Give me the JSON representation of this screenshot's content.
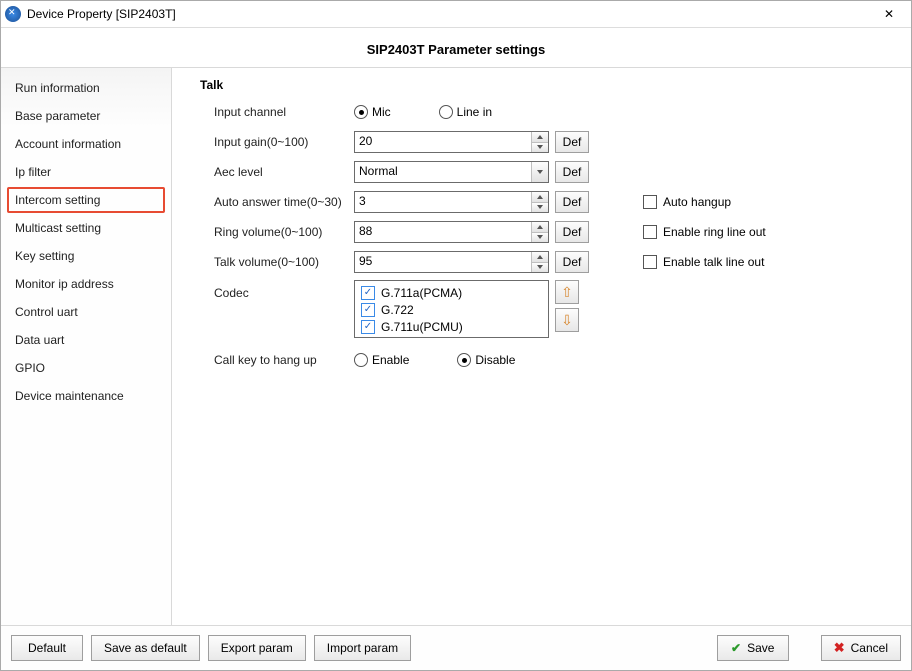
{
  "titlebar": {
    "title": "Device Property [SIP2403T]"
  },
  "heading": "SIP2403T Parameter settings",
  "sidebar": {
    "items": [
      {
        "label": "Run information",
        "selected": false
      },
      {
        "label": "Base parameter",
        "selected": false
      },
      {
        "label": "Account information",
        "selected": false
      },
      {
        "label": "Ip filter",
        "selected": false
      },
      {
        "label": "Intercom setting",
        "selected": true
      },
      {
        "label": "Multicast setting",
        "selected": false
      },
      {
        "label": "Key setting",
        "selected": false
      },
      {
        "label": "Monitor ip address",
        "selected": false
      },
      {
        "label": "Control uart",
        "selected": false
      },
      {
        "label": "Data uart",
        "selected": false
      },
      {
        "label": "GPIO",
        "selected": false
      },
      {
        "label": "Device maintenance",
        "selected": false
      }
    ]
  },
  "section_title": "Talk",
  "def_label": "Def",
  "rows": {
    "input_channel": {
      "label": "Input channel",
      "opt1": "Mic",
      "opt2": "Line in",
      "selected": "Mic"
    },
    "input_gain": {
      "label": "Input gain(0~100)",
      "value": "20"
    },
    "aec_level": {
      "label": "Aec level",
      "value": "Normal"
    },
    "auto_answer": {
      "label": "Auto answer time(0~30)",
      "value": "3",
      "extra_label": "Auto hangup"
    },
    "ring_volume": {
      "label": "Ring volume(0~100)",
      "value": "88",
      "extra_label": "Enable ring line out"
    },
    "talk_volume": {
      "label": "Talk volume(0~100)",
      "value": "95",
      "extra_label": "Enable talk line out"
    },
    "codec": {
      "label": "Codec",
      "items": [
        "G.711a(PCMA)",
        "G.722",
        "G.711u(PCMU)"
      ]
    },
    "call_key": {
      "label": "Call key to hang up",
      "opt1": "Enable",
      "opt2": "Disable",
      "selected": "Disable"
    }
  },
  "footer": {
    "default": "Default",
    "save_as_default": "Save as default",
    "export_param": "Export param",
    "import_param": "Import param",
    "save": "Save",
    "cancel": "Cancel"
  }
}
